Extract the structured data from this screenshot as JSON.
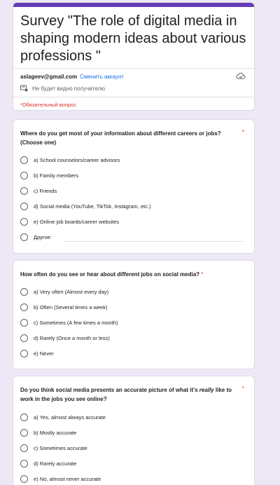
{
  "header": {
    "title": "Survey \"The role of digital media in shaping modern ideas about various professions \"",
    "email": "aslageev@gmail.com",
    "switch_account": "Сменить аккаунт",
    "privacy_note": "Не будет видно получателю",
    "required_note": "*Обязательный вопрос",
    "accent_color": "#673ab7"
  },
  "questions": [
    {
      "title": "Where do you get most of your information about different careers or jobs? (Choose one)",
      "required_mark": "*",
      "options": [
        "a) School counselors/career advisors",
        "b) Family members",
        "c) Friends",
        "d) Social media (YouTube, TikTok, Instagram, etc.)",
        "e) Online job boards/career websites",
        "Другое:"
      ]
    },
    {
      "title": "How often do you see or hear about different jobs on social media?",
      "required_mark": "*",
      "options": [
        "a) Very often (Almost every day)",
        "b) Often (Several times a week)",
        "c) Sometimes (A few times a month)",
        "d) Rarely (Once a month or less)",
        "e) Never"
      ]
    },
    {
      "title_before": "Do you think social media presents an accurate picture of what it's ",
      "title_em": "really",
      "title_after": " like to work in the jobs you see online?",
      "required_mark": "*",
      "options": [
        "a) Yes, almost always accurate",
        "b) Mostly accurate",
        "c) Sometimes accurate",
        "d) Rarely accurate",
        "e) No, almost never accurate"
      ]
    }
  ]
}
